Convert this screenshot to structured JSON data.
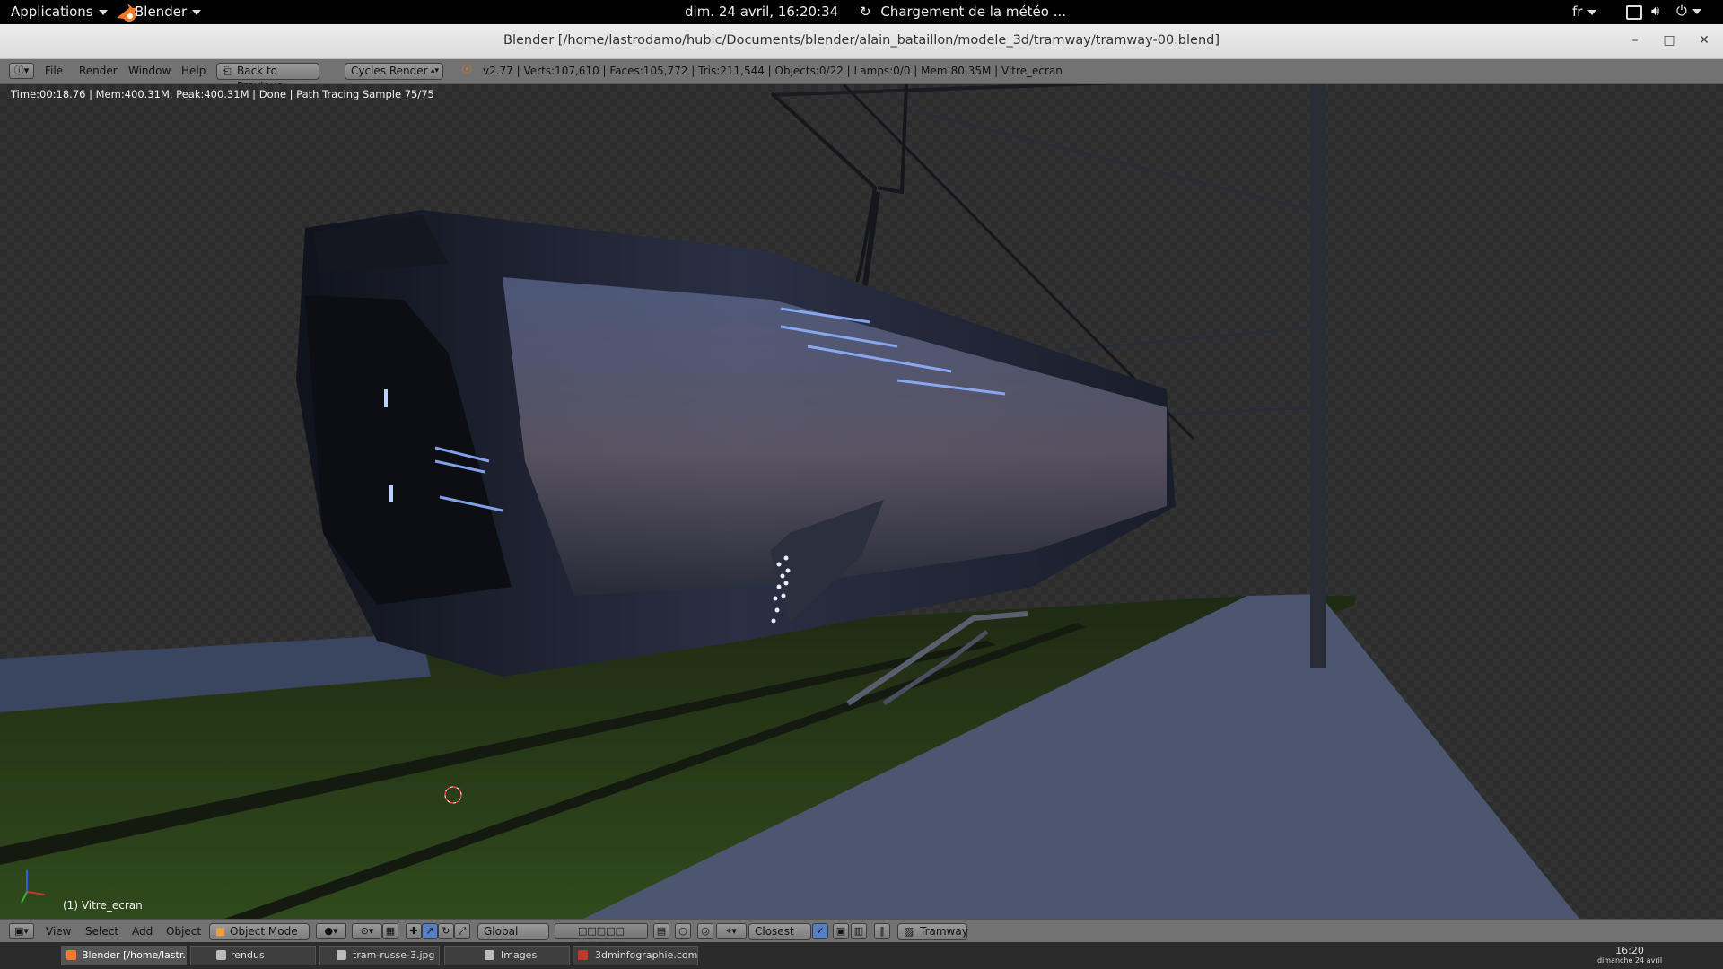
{
  "topbar": {
    "applications": "Applications",
    "app_name": "Blender",
    "datetime": "dim. 24 avril, 16:20:34",
    "weather": "Chargement de la météo ...",
    "lang": "fr"
  },
  "window": {
    "title": "Blender [/home/lastrodamo/hubic/Documents/blender/alain_bataillon/modele_3d/tramway/tramway-00.blend]"
  },
  "info_header": {
    "menus": [
      "File",
      "Render",
      "Window",
      "Help"
    ],
    "back_button": "Back to Previous",
    "engine": "Cycles Render",
    "stats": "v2.77 | Verts:107,610 | Faces:105,772 | Tris:211,544 | Objects:0/22 | Lamps:0/0 | Mem:80.35M | Vitre_ecran"
  },
  "render": {
    "status": "Time:00:18.76 | Mem:400.31M, Peak:400.31M | Done | Path Tracing Sample 75/75",
    "object_label": "(1) Vitre_ecran"
  },
  "view_header": {
    "menus": [
      "View",
      "Select",
      "Add",
      "Object"
    ],
    "mode": "Object Mode",
    "orientation": "Global",
    "snap": "Closest",
    "scene": "Tramway"
  },
  "taskbar": {
    "tasks": [
      "Blender [/home/lastr...",
      "rendus",
      "tram-russe-3.jpg",
      "Images",
      "3dminfographie.com..."
    ],
    "time": "16:20",
    "date": "dimanche 24 avril"
  }
}
